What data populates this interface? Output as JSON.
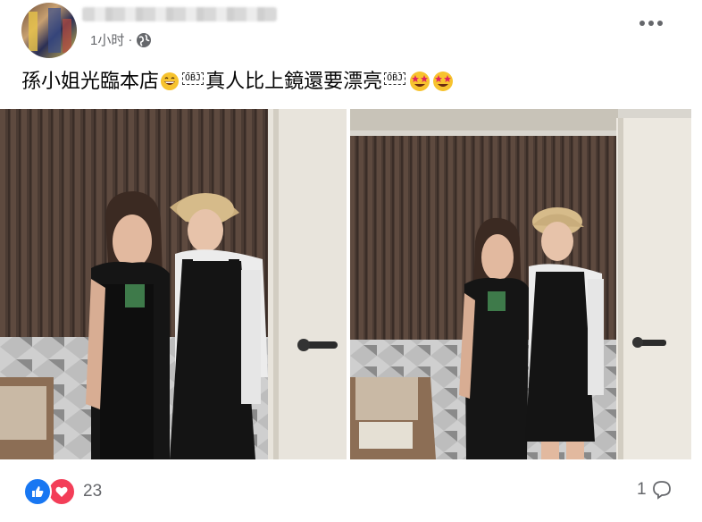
{
  "post": {
    "timestamp": "1小时",
    "separator": "·",
    "caption_part1": "孫小姐光臨本店",
    "obj_tag": "OBJ",
    "caption_part2": "真人比上鏡還要漂亮",
    "audience_icon": "globe-icon",
    "more_icon": "more-options-icon"
  },
  "reactions": {
    "count": "23",
    "icons": [
      "like-icon",
      "love-icon"
    ]
  },
  "comments": {
    "count": "1",
    "icon": "comment-icon"
  },
  "colors": {
    "meta_gray": "#65676b",
    "like_blue": "#1877f2",
    "love_red": "#f33e58"
  }
}
